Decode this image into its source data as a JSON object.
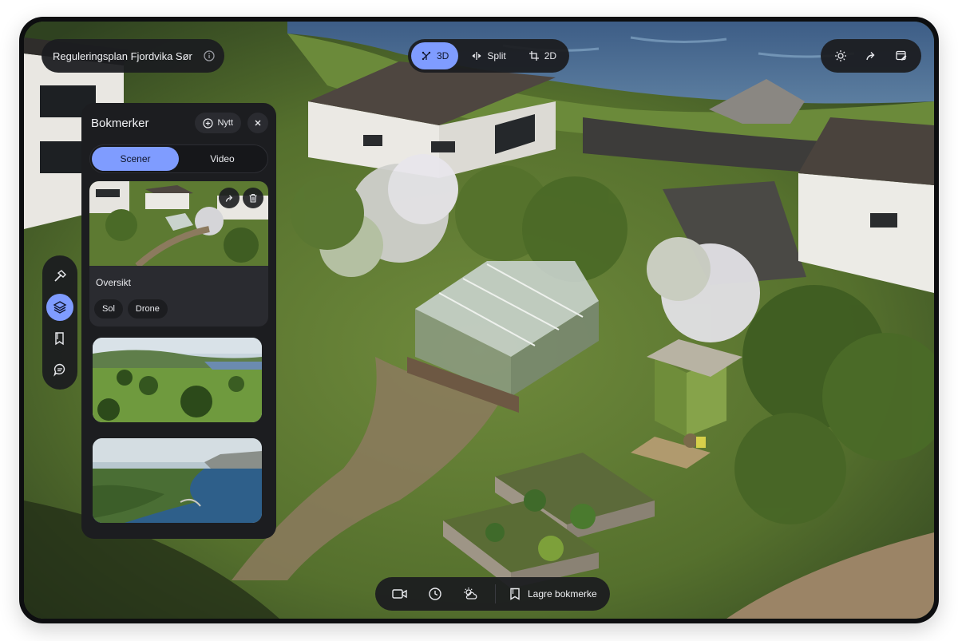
{
  "header": {
    "project_title": "Reguleringsplan Fjordvika Sør"
  },
  "view_modes": [
    {
      "label": "3D",
      "icon": "3d-cube-icon",
      "active": true
    },
    {
      "label": "Split",
      "icon": "split-view-icon",
      "active": false
    },
    {
      "label": "2D",
      "icon": "2d-crop-icon",
      "active": false
    }
  ],
  "top_tools": [
    "sun-icon",
    "share-icon",
    "edit-sheet-icon"
  ],
  "side_tools": [
    {
      "icon": "hammer-icon",
      "active": false
    },
    {
      "icon": "layers-icon",
      "active": true
    },
    {
      "icon": "bookmark-icon",
      "active": false
    },
    {
      "icon": "comment-icon",
      "active": false
    }
  ],
  "bookmarks": {
    "title": "Bokmerker",
    "new_label": "Nytt",
    "tabs": [
      {
        "label": "Scener",
        "active": true
      },
      {
        "label": "Video",
        "active": false
      }
    ],
    "items": [
      {
        "name": "Oversikt",
        "tags": [
          "Sol",
          "Drone"
        ],
        "selected": true
      },
      {
        "name": "",
        "tags": []
      },
      {
        "name": "",
        "tags": []
      }
    ]
  },
  "bottom_toolbar": {
    "tools": [
      "video-camera-icon",
      "clock-icon",
      "weather-icon"
    ],
    "save_label": "Lagre bokmerke"
  },
  "colors": {
    "accent": "#7f9cff",
    "panel": "#1c1d20",
    "toolbar": "#1c1d20"
  }
}
